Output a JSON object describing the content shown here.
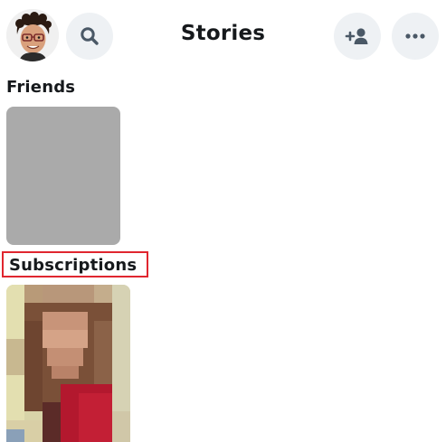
{
  "header": {
    "title": "Stories",
    "avatar_icon": "bitmoji-avatar-icon",
    "search_icon": "search-icon",
    "add_friend_icon": "add-friend-icon",
    "more_icon": "more-options-icon"
  },
  "sections": {
    "friends": {
      "heading": "Friends"
    },
    "subscriptions": {
      "heading": "Subscriptions",
      "highlight_color": "#e0262f"
    }
  },
  "colors": {
    "icon_button_bg": "#eef1f4",
    "icon_color": "#4a5866",
    "placeholder_tile": "#aaaaaa"
  }
}
